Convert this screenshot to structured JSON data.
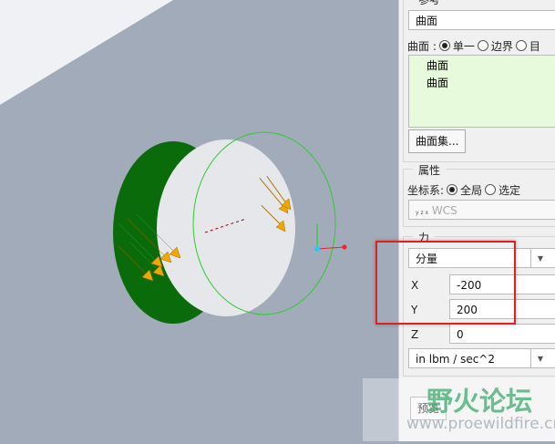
{
  "reference": {
    "legend": "参考",
    "selected": "曲面",
    "type_label": "曲面 :",
    "options": [
      "单一",
      "边界",
      "目"
    ],
    "list": [
      "曲面",
      "曲面"
    ],
    "surface_set_button": "曲面集..."
  },
  "properties": {
    "legend": "属性",
    "csys_label": "坐标系:",
    "options": [
      "全局",
      "选定"
    ],
    "csys_value": "WCS",
    "csys_axes": "y z x"
  },
  "force": {
    "legend": "力",
    "mode": "分量",
    "x_label": "X",
    "x_value": "-200",
    "y_label": "Y",
    "y_value": "200",
    "z_label": "Z",
    "z_value": "0",
    "units": "in lbm / sec^2"
  },
  "preview_button": "预览",
  "watermark": {
    "title": "野火论坛",
    "url": "www.proewildfire.cn"
  },
  "colors": {
    "highlight": "#e02020",
    "surface": "#0a6b0a",
    "arrow": "#f0a800"
  }
}
